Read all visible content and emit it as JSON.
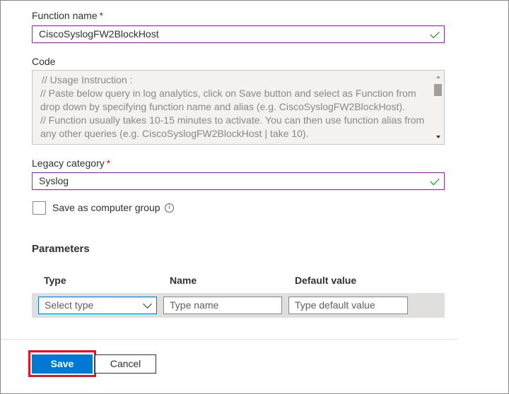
{
  "function_name": {
    "label": "Function name",
    "required_mark": "*",
    "value": "CiscoSyslogFW2BlockHost",
    "valid_icon": "checkmark-icon"
  },
  "code": {
    "label": "Code",
    "lines": [
      "// Usage Instruction :",
      "// Paste below query in log analytics, click on Save button and select as Function from",
      "drop down by specifying function name and alias (e.g. CiscoSyslogFW2BlockHost).",
      "// Function usually takes 10-15 minutes to activate. You can then use function alias from",
      "any other queries (e.g. CiscoSyslogFW2BlockHost | take 10)."
    ]
  },
  "legacy_category": {
    "label": "Legacy category",
    "required_mark": "*",
    "value": "Syslog",
    "valid_icon": "checkmark-icon"
  },
  "computer_group": {
    "label": "Save as computer group",
    "checked": false,
    "info_icon": "info-icon",
    "info_glyph": "i"
  },
  "parameters": {
    "title": "Parameters",
    "columns": [
      "Type",
      "Name",
      "Default value"
    ],
    "row": {
      "type_placeholder": "Select type",
      "name_placeholder": "Type name",
      "default_placeholder": "Type default value"
    }
  },
  "actions": {
    "save_label": "Save",
    "cancel_label": "Cancel"
  },
  "colors": {
    "accent": "#0078d4",
    "focus_border": "#8a2da5",
    "valid": "#107c10",
    "required": "#a4262c",
    "highlight": "#e81123"
  }
}
